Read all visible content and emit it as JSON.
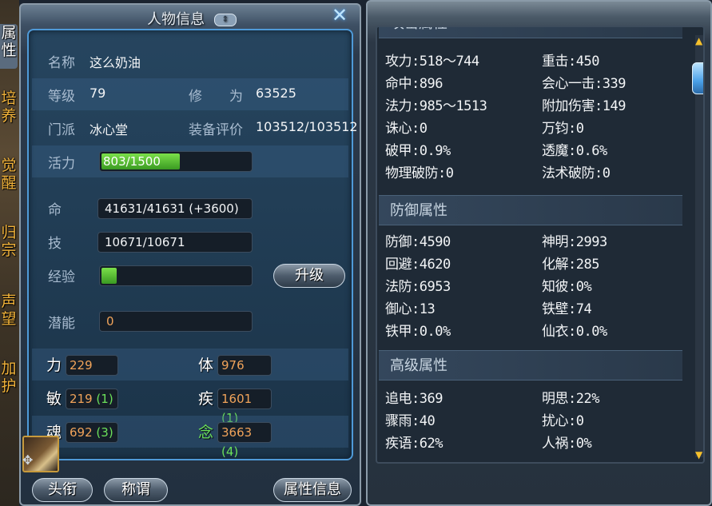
{
  "side_tabs": [
    "属性",
    "培养",
    "觉醒",
    "归宗",
    "声望",
    "加护"
  ],
  "window": {
    "title": "人物信息",
    "badge": "⇕",
    "close": "✕"
  },
  "profile": {
    "name_label": "名称",
    "name": "这么奶油",
    "level_label": "等级",
    "level": "79",
    "cultivation_label": "修　　为",
    "cultivation": "63525",
    "faction_label": "门派",
    "faction": "冰心堂",
    "gear_score_label": "装备评价",
    "gear_score": "103512/103512"
  },
  "vitality": {
    "label": "活力",
    "text": "803/1500",
    "fraction": 0.535
  },
  "resources": {
    "hp_label": "命",
    "hp": "41631/41631 (+3600)",
    "skill_label": "技",
    "skill": "10671/10671",
    "exp_label": "经验",
    "exp_fraction": 0.12,
    "upgrade_label": "升级"
  },
  "potential": {
    "label": "潜能",
    "value": "0"
  },
  "stats": [
    {
      "label": "力",
      "value": "229",
      "bonus": ""
    },
    {
      "label": "体",
      "value": "976",
      "bonus": ""
    },
    {
      "label": "敏",
      "value": "219",
      "bonus": "(1)"
    },
    {
      "label": "疾",
      "value": "1601",
      "bonus": "(1)"
    },
    {
      "label": "魂",
      "value": "692",
      "bonus": "(3)"
    },
    {
      "label": "念",
      "value": "3663",
      "bonus": "(4)"
    }
  ],
  "bottom_buttons": [
    "头衔",
    "称谓",
    "属性信息"
  ],
  "attributes": {
    "section1_partial": "攻击属性",
    "offense": [
      "攻力:518～744",
      "重击:450",
      "命中:896",
      "会心一击:339",
      "法力:985～1513",
      "附加伤害:149",
      "诛心:0",
      "万钧:0",
      "破甲:0.9%",
      "透魔:0.6%",
      "物理破防:0",
      "法术破防:0"
    ],
    "section2": "防御属性",
    "defense": [
      "防御:4590",
      "神明:2993",
      "回避:4620",
      "化解:285",
      "法防:6953",
      "知彼:0%",
      "御心:13",
      "铁壁:74",
      "铁甲:0.0%",
      "仙衣:0.0%"
    ],
    "section3": "高级属性",
    "advanced": [
      "追电:369",
      "明思:22%",
      "骤雨:40",
      "扰心:0",
      "疾语:62%",
      "人祸:0%"
    ]
  }
}
